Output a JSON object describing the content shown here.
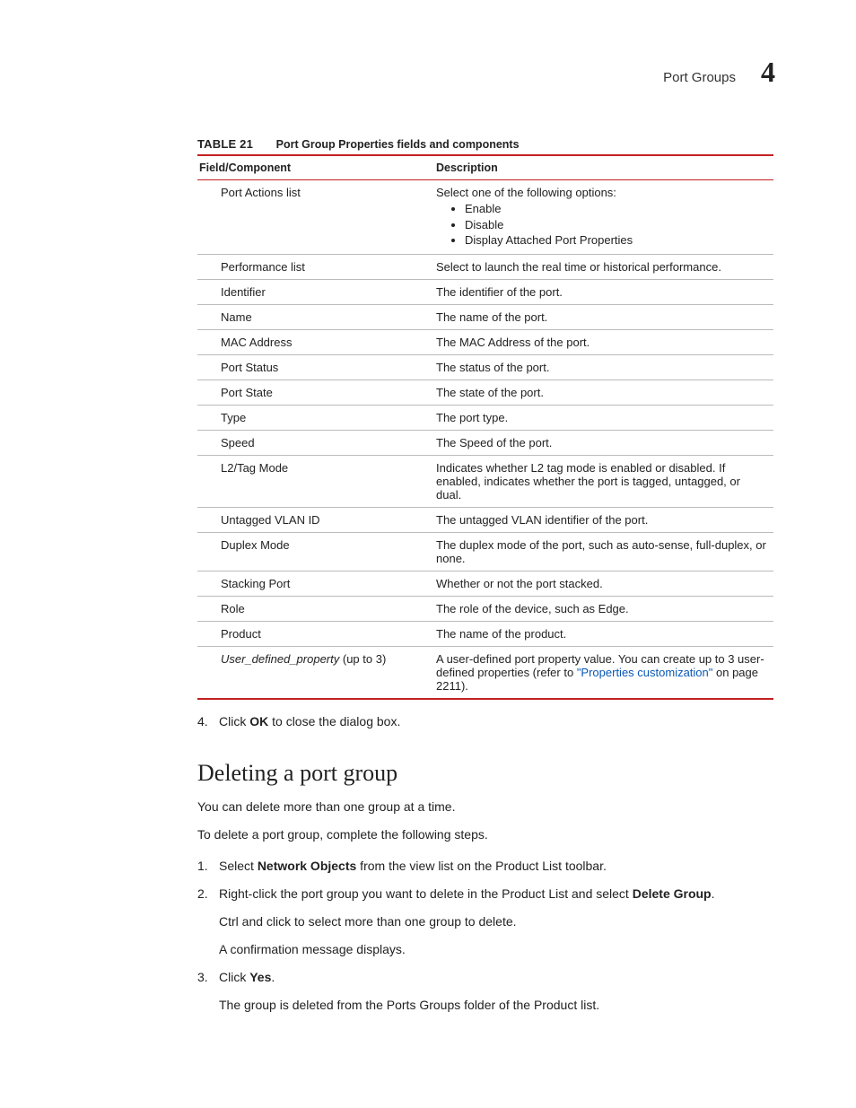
{
  "header": {
    "running_title": "Port Groups",
    "chapter_number": "4"
  },
  "table": {
    "label": "TABLE 21",
    "title": "Port Group Properties fields and components",
    "head": {
      "col1": "Field/Component",
      "col2": "Description"
    },
    "rows": [
      {
        "field": "Port Actions list",
        "desc_intro": "Select one of the following options:",
        "bullets": [
          "Enable",
          "Disable",
          "Display Attached Port Properties"
        ]
      },
      {
        "field": "Performance list",
        "desc": "Select to launch the real time or historical performance."
      },
      {
        "field": "Identifier",
        "desc": "The identifier of the port."
      },
      {
        "field": "Name",
        "desc": "The name of the port."
      },
      {
        "field": "MAC Address",
        "desc": "The MAC Address of the port."
      },
      {
        "field": "Port Status",
        "desc": "The status of the port."
      },
      {
        "field": "Port State",
        "desc": "The state of the port."
      },
      {
        "field": "Type",
        "desc": "The port type."
      },
      {
        "field": "Speed",
        "desc": "The Speed of the port."
      },
      {
        "field": "L2/Tag Mode",
        "desc": "Indicates whether L2 tag mode is enabled or disabled. If enabled, indicates whether the port is tagged, untagged, or dual."
      },
      {
        "field": "Untagged VLAN ID",
        "desc": "The untagged VLAN identifier of the port."
      },
      {
        "field": "Duplex Mode",
        "desc": "The duplex mode of the port, such as auto-sense, full-duplex, or none."
      },
      {
        "field": "Stacking Port",
        "desc": "Whether or not the port stacked."
      },
      {
        "field": "Role",
        "desc": "The role of the device, such as Edge."
      },
      {
        "field": "Product",
        "desc": "The name of the product."
      },
      {
        "field_italic": "User_defined_property",
        "field_suffix": " (up to 3)",
        "desc_parts": {
          "pre": "A user-defined port property value. You can create up to 3 user-defined properties (refer to ",
          "link": "\"Properties customization\"",
          "post": " on page 2211)."
        }
      }
    ]
  },
  "after_table_step": {
    "num": "4.",
    "pre": "Click ",
    "bold": "OK",
    "post": " to close the dialog box."
  },
  "section": {
    "title": "Deleting a port group",
    "intro1": "You can delete more than one group at a time.",
    "intro2": "To delete a port group, complete the following steps.",
    "steps": [
      {
        "num": "1.",
        "parts": [
          {
            "t": "Select "
          },
          {
            "b": "Network Objects"
          },
          {
            "t": " from the view list on the Product List toolbar."
          }
        ]
      },
      {
        "num": "2.",
        "parts": [
          {
            "t": "Right-click the port group you want to delete in the Product List and select "
          },
          {
            "b": "Delete Group"
          },
          {
            "t": "."
          }
        ],
        "extra": [
          "Ctrl and click to select more than one group to delete.",
          "A confirmation message displays."
        ]
      },
      {
        "num": "3.",
        "parts": [
          {
            "t": "Click "
          },
          {
            "b": "Yes"
          },
          {
            "t": "."
          }
        ],
        "extra": [
          "The group is deleted from the Ports Groups folder of the Product list."
        ]
      }
    ]
  }
}
